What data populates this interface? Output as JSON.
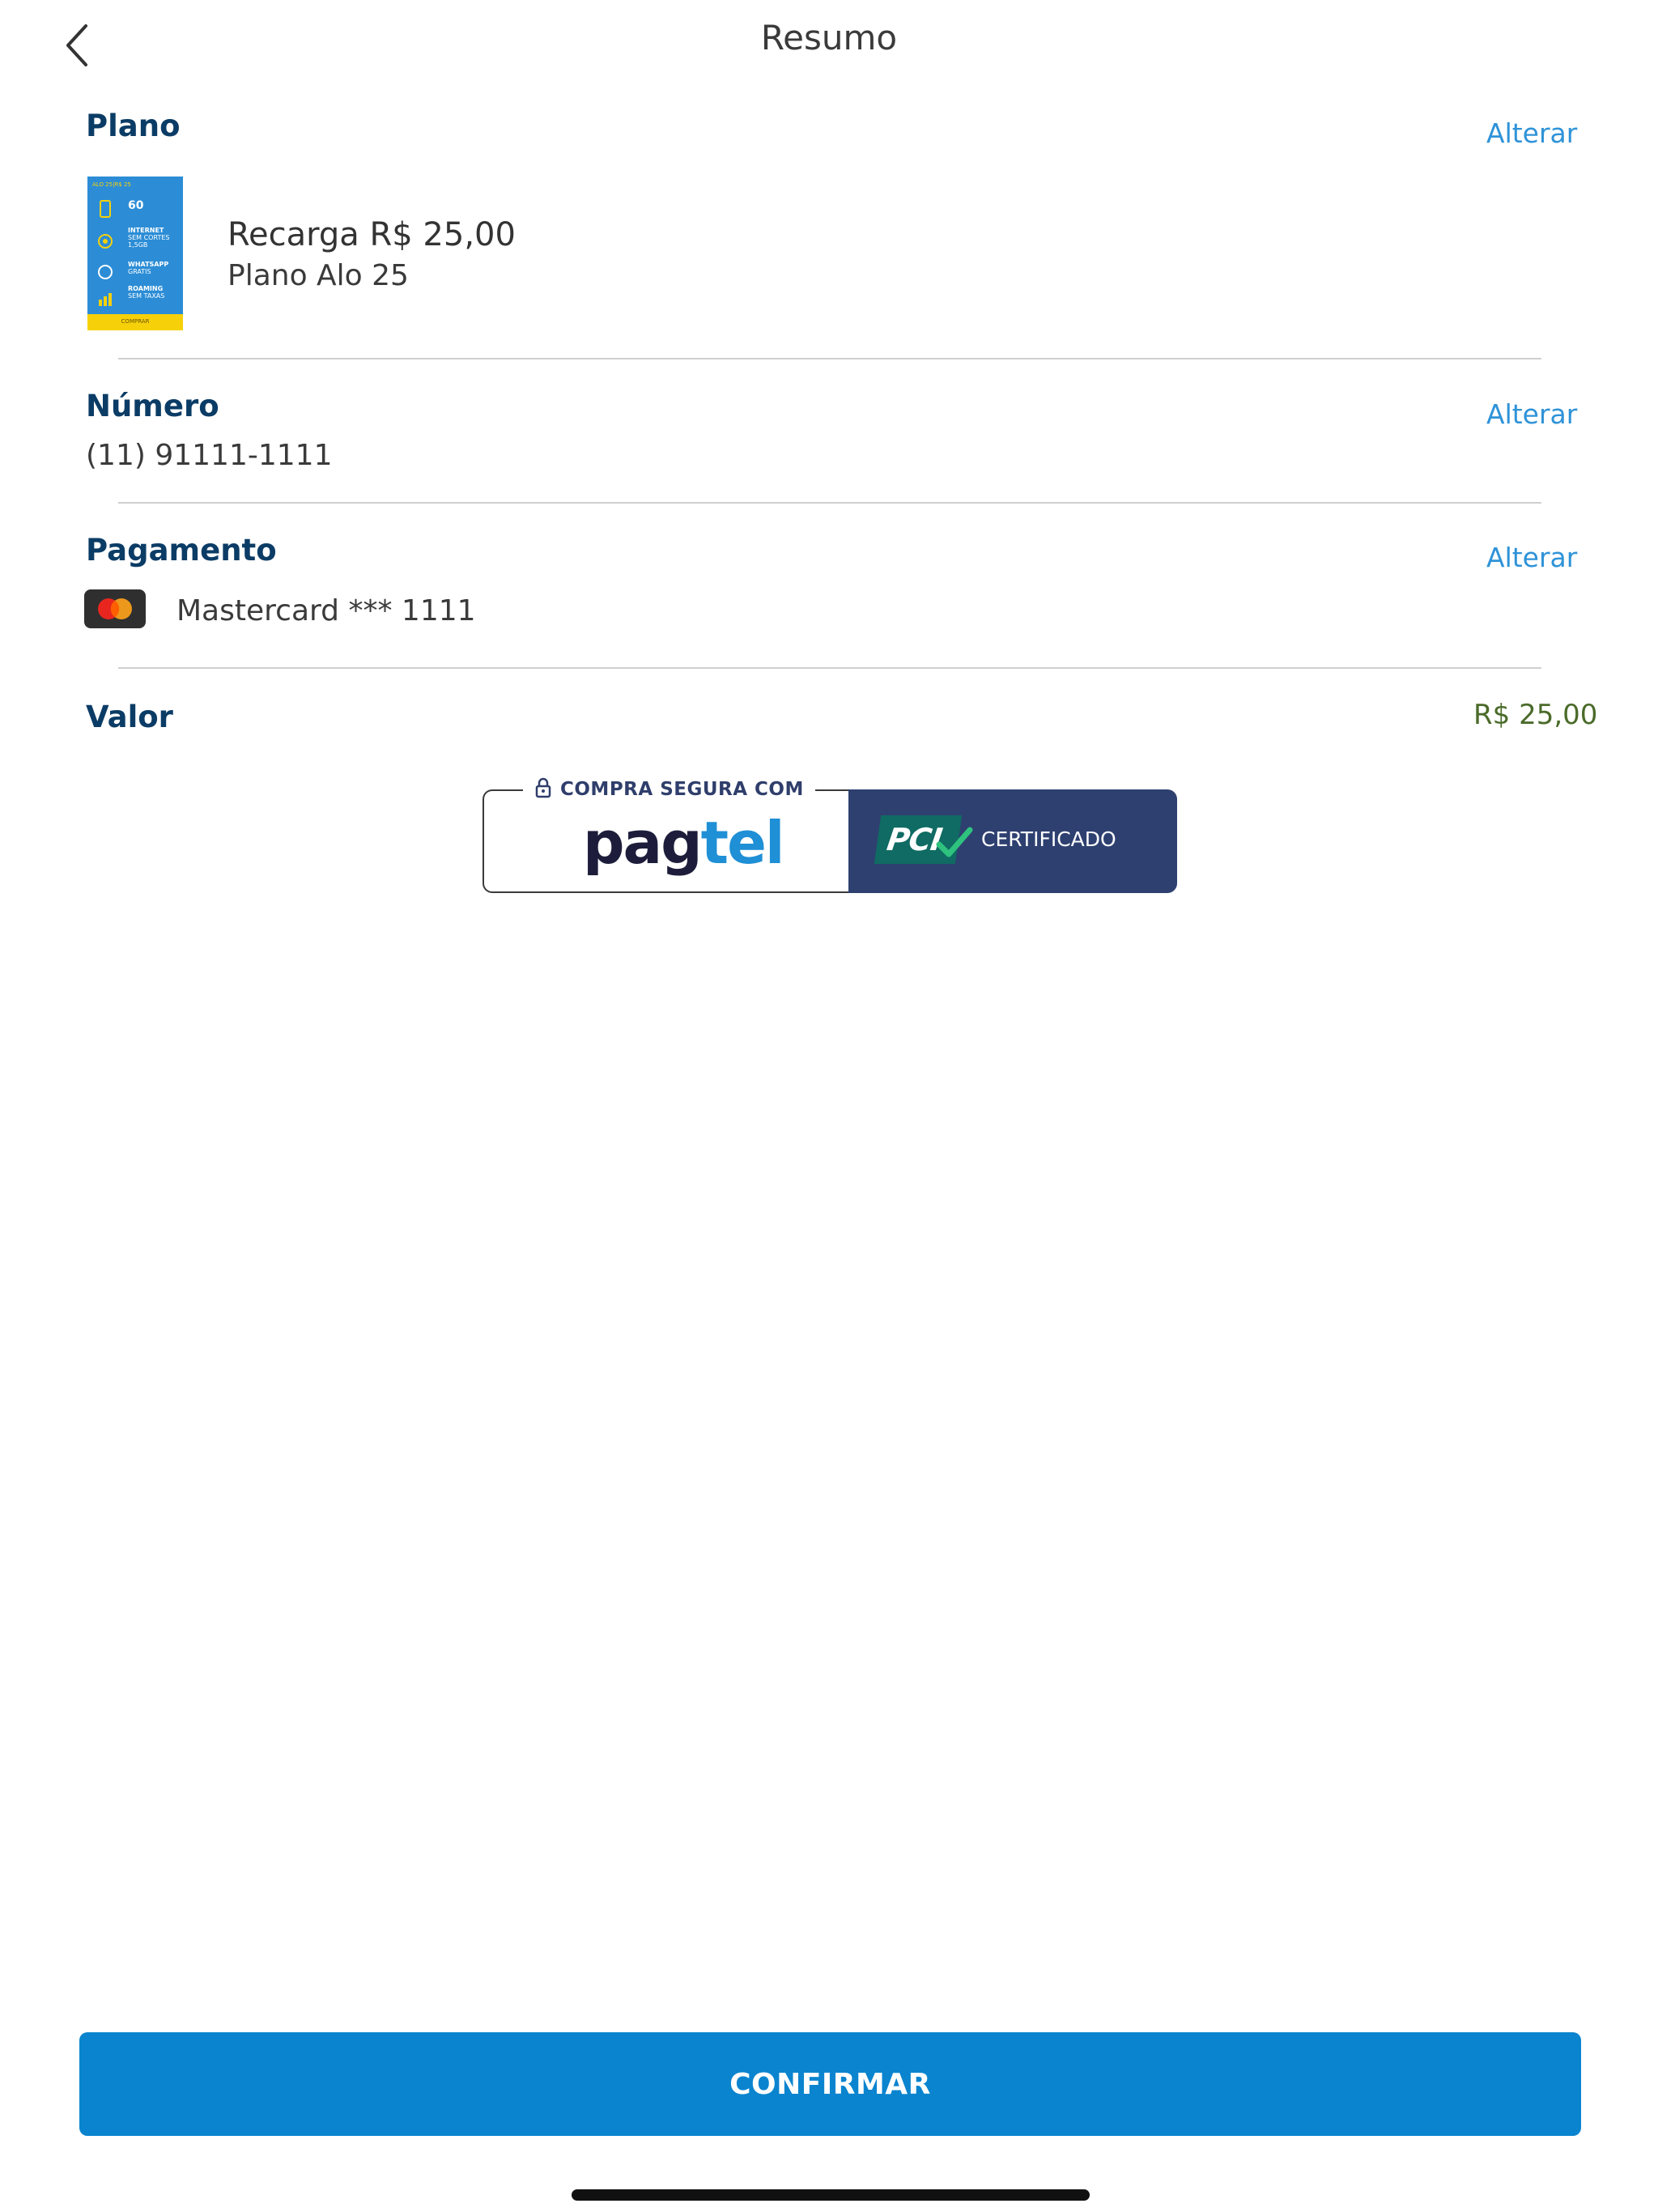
{
  "header": {
    "title": "Resumo"
  },
  "plan": {
    "title": "Plano",
    "alter_label": "Alterar",
    "name": "Recarga R$ 25,00",
    "subtitle": "Plano Alo 25",
    "thumbnail": {
      "header": "ALO 25|R$ 25",
      "minutes": "60",
      "internet": "INTERNET",
      "internet_sub": "SEM CORTES",
      "internet_amount": "1,5GB",
      "whatsapp": "WHATSAPP",
      "whatsapp_sub": "GRATIS",
      "roaming": "ROAMING",
      "roaming_sub": "SEM TAXAS",
      "cta": "COMPRAR"
    }
  },
  "number": {
    "title": "Número",
    "alter_label": "Alterar",
    "value": "(11) 91111-1111"
  },
  "payment": {
    "title": "Pagamento",
    "alter_label": "Alterar",
    "card_label": "Mastercard *** 1111"
  },
  "total": {
    "title": "Valor",
    "amount": "R$ 25,00"
  },
  "secure_badge": {
    "label": "COMPRA SEGURA COM",
    "brand": "pagtel",
    "pci": "PCI",
    "certified": "CERTIFICADO"
  },
  "actions": {
    "confirm_label": "CONFIRMAR"
  },
  "colors": {
    "section_title": "#0b3c66",
    "link": "#2f93d8",
    "amount": "#4b6b2a",
    "primary_button": "#0a84cf",
    "badge_dark": "#2e4070",
    "pagtel_accent": "#1f8fd6",
    "pci_green": "#2ec27e"
  }
}
